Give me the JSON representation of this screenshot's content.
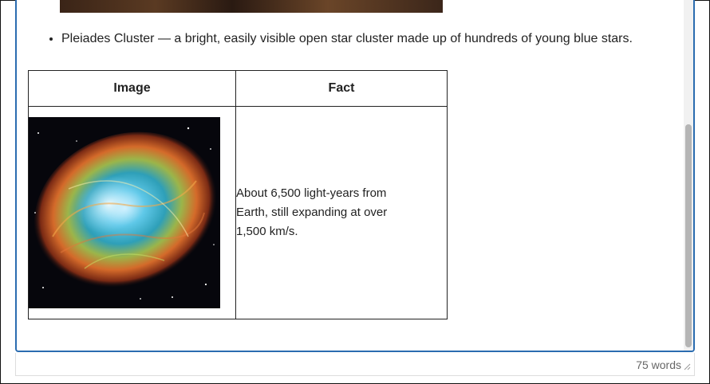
{
  "content": {
    "bullets": [
      "Pleiades Cluster — a bright, easily visible open star cluster made up of hundreds of young blue stars."
    ],
    "table": {
      "headers": [
        "Image",
        "Fact"
      ],
      "rows": [
        {
          "image_icon": "crab-nebula-image",
          "fact": "About 6,500 light-years from Earth, still expanding at over 1,500 km/s."
        }
      ]
    }
  },
  "status_bar": {
    "word_count": "75 words"
  },
  "colors": {
    "focus_border": "#2b6cb0",
    "scroll_thumb": "#b5b5b5"
  }
}
